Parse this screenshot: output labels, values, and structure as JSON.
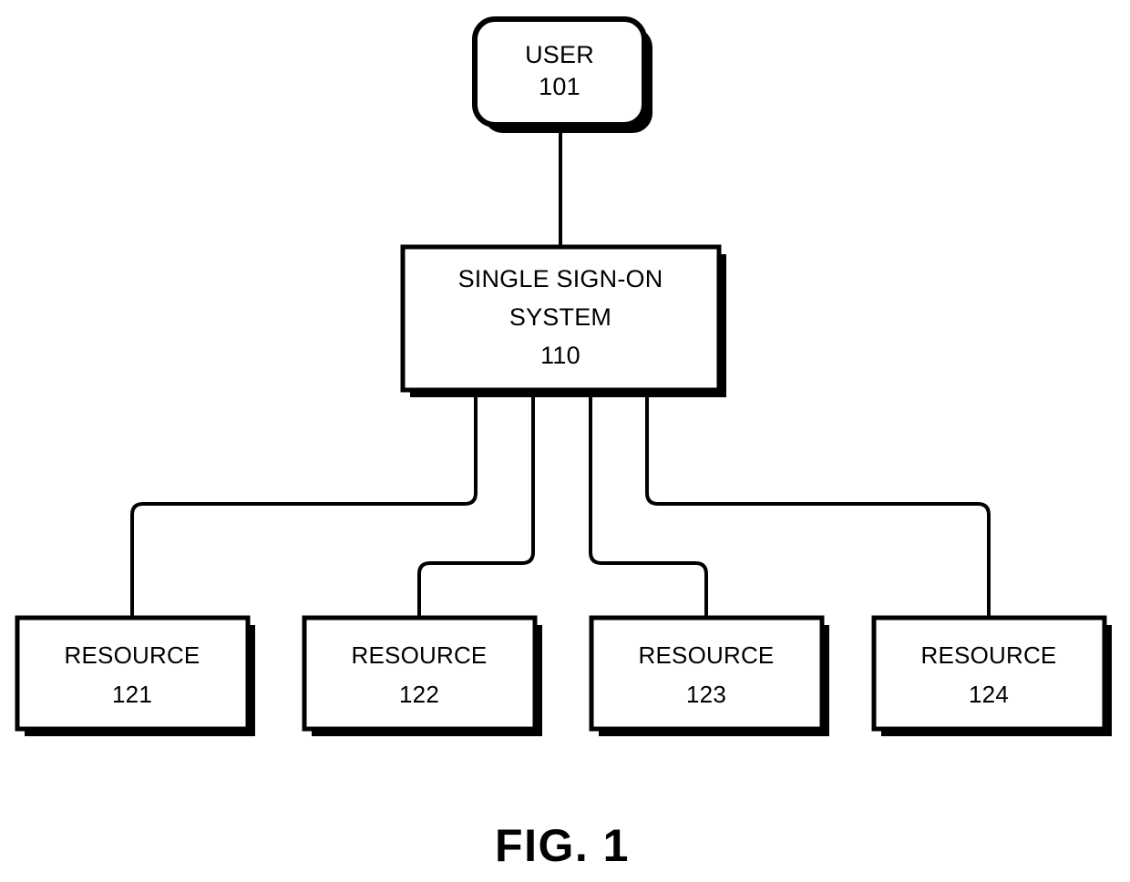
{
  "figure": {
    "caption": "FIG. 1",
    "background_color": "#ffffff",
    "line_color": "#000000"
  },
  "nodes": {
    "user": {
      "label": "USER",
      "ref": "101",
      "shape": "rounded-rectangle"
    },
    "sso": {
      "label_line1": "SINGLE SIGN-ON",
      "label_line2": "SYSTEM",
      "ref": "110",
      "shape": "rectangle"
    },
    "resources": [
      {
        "label": "RESOURCE",
        "ref": "121",
        "shape": "rectangle"
      },
      {
        "label": "RESOURCE",
        "ref": "122",
        "shape": "rectangle"
      },
      {
        "label": "RESOURCE",
        "ref": "123",
        "shape": "rectangle"
      },
      {
        "label": "RESOURCE",
        "ref": "124",
        "shape": "rectangle"
      }
    ]
  },
  "connections": [
    {
      "from": "user",
      "to": "sso"
    },
    {
      "from": "sso",
      "to": "resource-121"
    },
    {
      "from": "sso",
      "to": "resource-122"
    },
    {
      "from": "sso",
      "to": "resource-123"
    },
    {
      "from": "sso",
      "to": "resource-124"
    }
  ]
}
